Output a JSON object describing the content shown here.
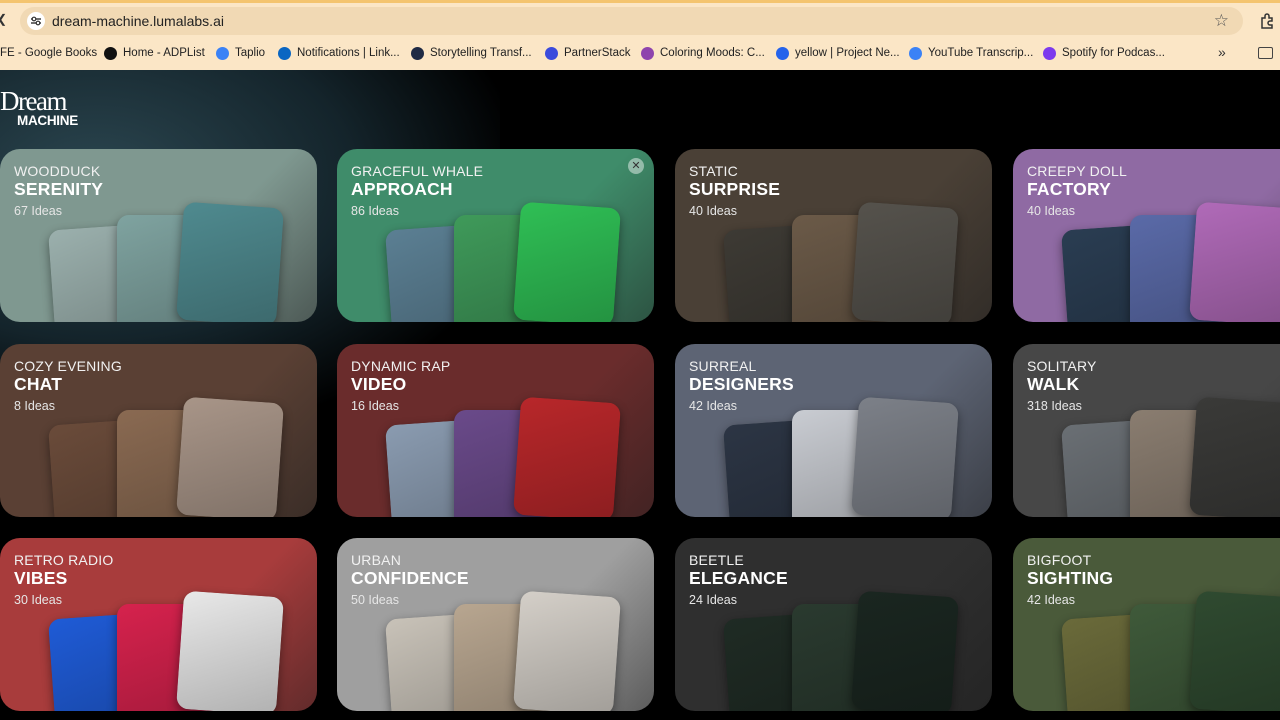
{
  "browser": {
    "url": "dream-machine.lumalabs.ai",
    "bookmarks": [
      {
        "label": "FE - Google Books",
        "icon": "book-icon",
        "color": "#4285f4"
      },
      {
        "label": "Home - ADPList",
        "icon": "adplist-icon",
        "color": "#111111"
      },
      {
        "label": "Taplio",
        "icon": "taplio-icon",
        "color": "#3b82f6"
      },
      {
        "label": "Notifications | Link...",
        "icon": "linkedin-icon",
        "color": "#0a66c2"
      },
      {
        "label": "Storytelling Transf...",
        "icon": "ltx-icon",
        "color": "#1f2a44"
      },
      {
        "label": "PartnerStack",
        "icon": "partnerstack-icon",
        "color": "#3b4bdc"
      },
      {
        "label": "Coloring Moods: C...",
        "icon": "coloring-icon",
        "color": "#8e44ad"
      },
      {
        "label": "yellow | Project Ne...",
        "icon": "ne-icon",
        "color": "#2563eb"
      },
      {
        "label": "YouTube Transcrip...",
        "icon": "youtube-transcript-icon",
        "color": "#3b82f6"
      },
      {
        "label": "Spotify for Podcas...",
        "icon": "spotify-icon",
        "color": "#7c3aed"
      }
    ]
  },
  "app": {
    "logo_line1": "Dream",
    "logo_line2": "MACHINE"
  },
  "cards": [
    {
      "sub": "WOODDUCK",
      "title": "SERENITY",
      "count": "67 Ideas",
      "bg": "#7f9890",
      "thumbs": [
        "#9bb0ad",
        "#7fa3a0",
        "#4f8a8f"
      ]
    },
    {
      "sub": "GRACEFUL WHALE",
      "title": "APPROACH",
      "count": "86 Ideas",
      "bg": "#3f8c6a",
      "thumbs": [
        "#5b7f93",
        "#3f9a5a",
        "#2fbf55"
      ]
    },
    {
      "sub": "STATIC",
      "title": "SURPRISE",
      "count": "40 Ideas",
      "bg": "#4a4036",
      "thumbs": [
        "#3d3a34",
        "#6b5a48",
        "#55524c"
      ]
    },
    {
      "sub": "CREEPY DOLL",
      "title": "FACTORY",
      "count": "40 Ideas",
      "bg": "#8f6aa3",
      "thumbs": [
        "#2a3d52",
        "#5a6aa8",
        "#b06ab8"
      ]
    },
    {
      "sub": "COZY EVENING",
      "title": "CHAT",
      "count": "8 Ideas",
      "bg": "#5a4034",
      "thumbs": [
        "#6a4b3a",
        "#8a6a52",
        "#a89588"
      ]
    },
    {
      "sub": "DYNAMIC RAP",
      "title": "VIDEO",
      "count": "16 Ideas",
      "bg": "#6a2c2c",
      "thumbs": [
        "#8a9bb0",
        "#6a4a8a",
        "#b8272a"
      ]
    },
    {
      "sub": "SURREAL",
      "title": "DESIGNERS",
      "count": "42 Ideas",
      "bg": "#5d6474",
      "thumbs": [
        "#2c3544",
        "#c9ccd2",
        "#7c8088"
      ]
    },
    {
      "sub": "SOLITARY",
      "title": "WALK",
      "count": "318 Ideas",
      "bg": "#474747",
      "thumbs": [
        "#6a6f74",
        "#8a7d70",
        "#3a3a38"
      ]
    },
    {
      "sub": "RETRO RADIO",
      "title": "VIBES",
      "count": "30 Ideas",
      "bg": "#a83c3c",
      "thumbs": [
        "#1f5bd6",
        "#d6224d",
        "#e8e8e8"
      ]
    },
    {
      "sub": "URBAN",
      "title": "CONFIDENCE",
      "count": "50 Ideas",
      "bg": "#9f9f9f",
      "thumbs": [
        "#c8c2b8",
        "#b8a690",
        "#d4cfc8"
      ]
    },
    {
      "sub": "BEETLE",
      "title": "ELEGANCE",
      "count": "24 Ideas",
      "bg": "#2f2f2f",
      "thumbs": [
        "#1f2b24",
        "#2a3a2f",
        "#1a2620"
      ]
    },
    {
      "sub": "BIGFOOT",
      "title": "SIGHTING",
      "count": "42 Ideas",
      "bg": "#4a5a3a",
      "thumbs": [
        "#6a6a3a",
        "#3f5a3a",
        "#2f4a30"
      ]
    }
  ]
}
